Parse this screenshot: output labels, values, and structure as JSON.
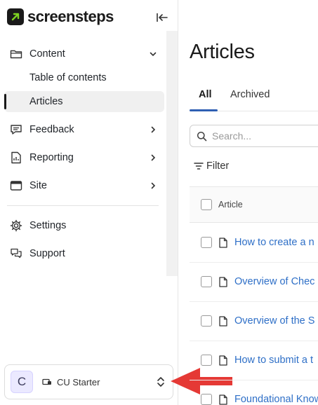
{
  "brand": {
    "name": "screensteps"
  },
  "sidebar": {
    "collapse_icon": "collapse-sidebar-icon",
    "sections": [
      {
        "label": "Content",
        "icon": "folder-icon",
        "chevron": "chevron-down-icon"
      },
      {
        "label": "Table of contents"
      },
      {
        "label": "Articles"
      },
      {
        "label": "Feedback",
        "icon": "feedback-icon",
        "chevron": "chevron-right-icon"
      },
      {
        "label": "Reporting",
        "icon": "report-icon",
        "chevron": "chevron-right-icon"
      },
      {
        "label": "Site",
        "icon": "site-icon",
        "chevron": "chevron-right-icon"
      },
      {
        "label": "Settings",
        "icon": "gear-icon"
      },
      {
        "label": "Support",
        "icon": "support-icon"
      }
    ],
    "workspace": {
      "initial": "C",
      "name": "CU Starter"
    }
  },
  "main": {
    "title": "Articles",
    "tabs": [
      {
        "label": "All"
      },
      {
        "label": "Archived"
      }
    ],
    "search": {
      "placeholder": "Search..."
    },
    "filter_label": "Filter",
    "table": {
      "header": "Article",
      "rows": [
        "How to create a n",
        "Overview of Chec",
        "Overview of the S",
        "How to submit a t",
        "Foundational Know"
      ]
    }
  },
  "colors": {
    "accent": "#2f5fb3",
    "link": "#2e6fc7",
    "arrow": "#e53935",
    "logo_green": "#7ed321"
  }
}
